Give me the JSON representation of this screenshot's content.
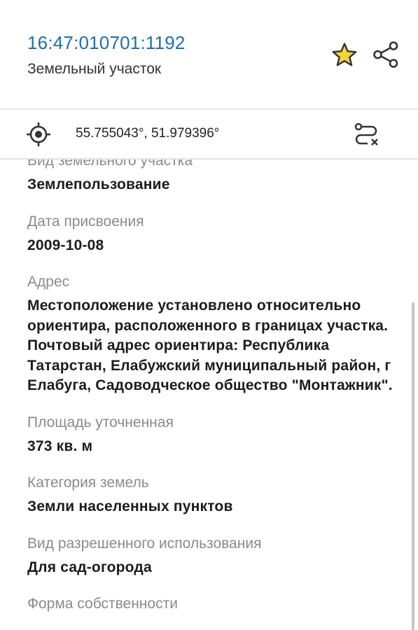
{
  "header": {
    "cadastral_number": "16:47:010701:1192",
    "object_type": "Земельный участок",
    "favorite_icon": "star-icon",
    "share_icon": "share-icon",
    "accent_color": "#1f6fa8",
    "star_color": "#e8c43a"
  },
  "coords_bar": {
    "coordinates": "55.755043°, 51.979396°",
    "locate_icon": "crosshair-icon",
    "route_icon": "route-icon"
  },
  "fields": [
    {
      "label": "Вид земельного участка",
      "value": "Землепользование"
    },
    {
      "label": "Дата присвоения",
      "value": "2009-10-08"
    },
    {
      "label": "Адрес",
      "value": "Местоположение установлено относительно ориентира, расположенного в границах участка. Почтовый адрес ориентира: Республика Татарстан, Елабужский муниципальный район, г Елабуга, Садоводческое общество \"Монтажник\"."
    },
    {
      "label": "Площадь уточненная",
      "value": "373 кв. м"
    },
    {
      "label": "Категория земель",
      "value": "Земли населенных пунктов"
    },
    {
      "label": "Вид разрешенного использования",
      "value": "Для сад-огорода"
    },
    {
      "label": "Форма собственности",
      "value": ""
    }
  ]
}
